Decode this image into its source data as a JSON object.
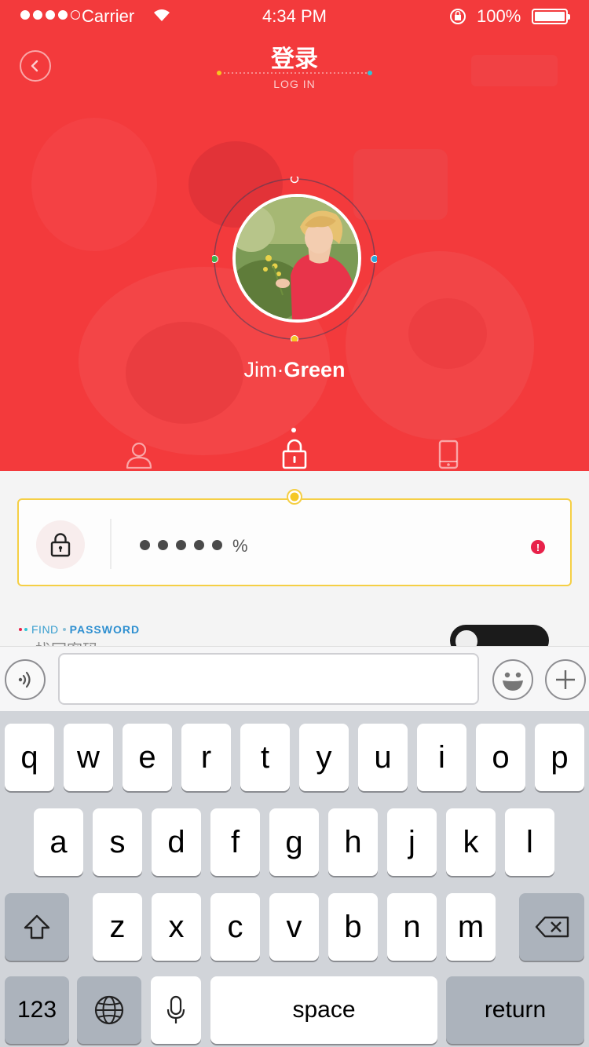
{
  "status_bar": {
    "carrier": "Carrier",
    "time": "4:34 PM",
    "battery_percent": "100%",
    "signal_strength": "4 of 5",
    "icons": [
      "signal-icon",
      "wifi-icon",
      "rotation-lock-icon",
      "battery-icon"
    ]
  },
  "header": {
    "title": "登录",
    "subtitle": "LOG IN",
    "back_icon": "chevron-left-icon"
  },
  "profile": {
    "first_name": "Jim",
    "separator": "·",
    "last_name": "Green"
  },
  "tabs": [
    {
      "name": "account",
      "icon": "user-icon",
      "active": false
    },
    {
      "name": "password",
      "icon": "lock-icon",
      "active": true
    },
    {
      "name": "phone",
      "icon": "phone-icon",
      "active": false
    }
  ],
  "password_field": {
    "masked_count": 5,
    "trailing_char": "%",
    "warning_symbol": "!"
  },
  "find_password": {
    "prefix": "FIND",
    "label": "PASSWORD",
    "cn_label": "找回密码"
  },
  "input_bar": {
    "text_value": "",
    "icons": [
      "voice-icon",
      "emoji-icon",
      "plus-icon"
    ]
  },
  "keyboard": {
    "row1": [
      "q",
      "w",
      "e",
      "r",
      "t",
      "y",
      "u",
      "i",
      "o",
      "p"
    ],
    "row2": [
      "a",
      "s",
      "d",
      "f",
      "g",
      "h",
      "j",
      "k",
      "l"
    ],
    "row3": [
      "z",
      "x",
      "c",
      "v",
      "b",
      "n",
      "m"
    ],
    "numbers_label": "123",
    "space_label": "space",
    "return_label": "return"
  },
  "colors": {
    "hero_red": "#f33a3c",
    "field_border": "#f5cf45",
    "link_blue": "#2e8fd0",
    "warning_red": "#e8214a",
    "keyboard_bg": "#d1d4d9"
  }
}
